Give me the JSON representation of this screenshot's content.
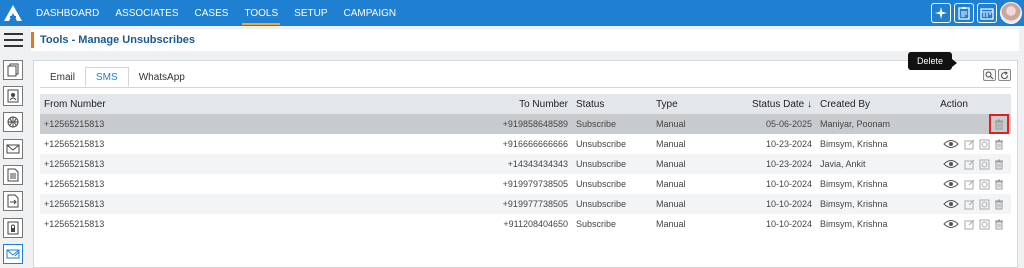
{
  "nav": {
    "items": [
      "DASHBOARD",
      "ASSOCIATES",
      "CASES",
      "TOOLS",
      "SETUP",
      "CAMPAIGN"
    ],
    "active": "TOOLS"
  },
  "page": {
    "title": "Tools - Manage Unsubscribes"
  },
  "tabs": [
    "Email",
    "SMS",
    "WhatsApp"
  ],
  "active_tab": "SMS",
  "table": {
    "headers": {
      "from": "From Number",
      "to": "To Number",
      "status": "Status",
      "type": "Type",
      "status_date": "Status Date ↓",
      "created_by": "Created By",
      "action": "Action"
    },
    "rows": [
      {
        "from": "+12565215813",
        "to": "+919858648589",
        "status": "Subscribe",
        "type": "Manual",
        "date": "05-06-2025",
        "by": "Maniyar, Poonam"
      },
      {
        "from": "+12565215813",
        "to": "+916666666666",
        "status": "Unsubscribe",
        "type": "Manual",
        "date": "10-23-2024",
        "by": "Bimsym, Krishna"
      },
      {
        "from": "+12565215813",
        "to": "+14343434343",
        "status": "Unsubscribe",
        "type": "Manual",
        "date": "10-23-2024",
        "by": "Javia, Ankit"
      },
      {
        "from": "+12565215813",
        "to": "+919979738505",
        "status": "Unsubscribe",
        "type": "Manual",
        "date": "10-10-2024",
        "by": "Bimsym, Krishna"
      },
      {
        "from": "+12565215813",
        "to": "+919977738505",
        "status": "Unsubscribe",
        "type": "Manual",
        "date": "10-10-2024",
        "by": "Bimsym, Krishna"
      },
      {
        "from": "+12565215813",
        "to": "+911208404650",
        "status": "Subscribe",
        "type": "Manual",
        "date": "10-10-2024",
        "by": "Bimsym, Krishna"
      }
    ]
  },
  "tooltip": "Delete",
  "colors": {
    "brand": "#1f7fd0",
    "accent": "#e87722",
    "focus": "#e02020"
  }
}
